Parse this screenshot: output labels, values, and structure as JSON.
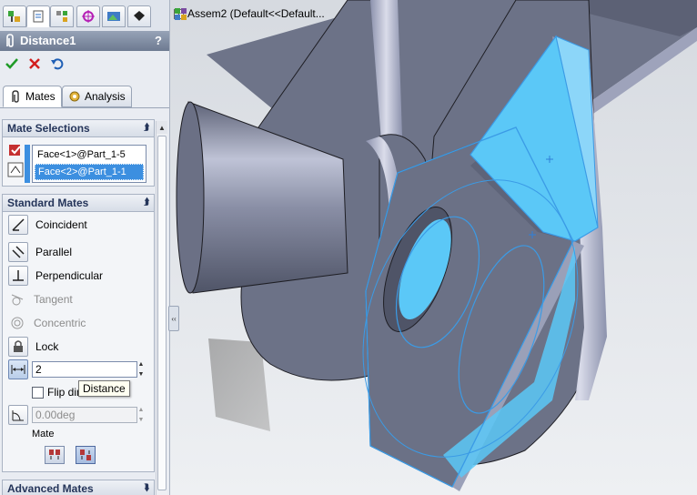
{
  "property_manager": {
    "title": "Distance1",
    "help": "?",
    "tabs": [
      "Mates",
      "Analysis"
    ]
  },
  "mate_selections": {
    "header": "Mate Selections",
    "items": [
      "Face<1>@Part_1-5",
      "Face<2>@Part_1-1"
    ]
  },
  "standard_mates": {
    "header": "Standard Mates",
    "coincident": "Coincident",
    "parallel": "Parallel",
    "perpendicular": "Perpendicular",
    "tangent": "Tangent",
    "concentric": "Concentric",
    "lock": "Lock",
    "distance_value": "2",
    "flip_dimension": "Flip dimension",
    "angle_value": "0.00deg",
    "mate_alignment": "Mate"
  },
  "tooltip": "Distance",
  "advanced_mates": {
    "header": "Advanced Mates"
  },
  "tree": {
    "root": "Assem2  (Default<<Default..."
  },
  "colors": {
    "selection_face": "#5bc8f7",
    "part_body": "#6e7489",
    "panel_bg": "#e9ecf2",
    "title_bar": "#7f8ba0"
  }
}
